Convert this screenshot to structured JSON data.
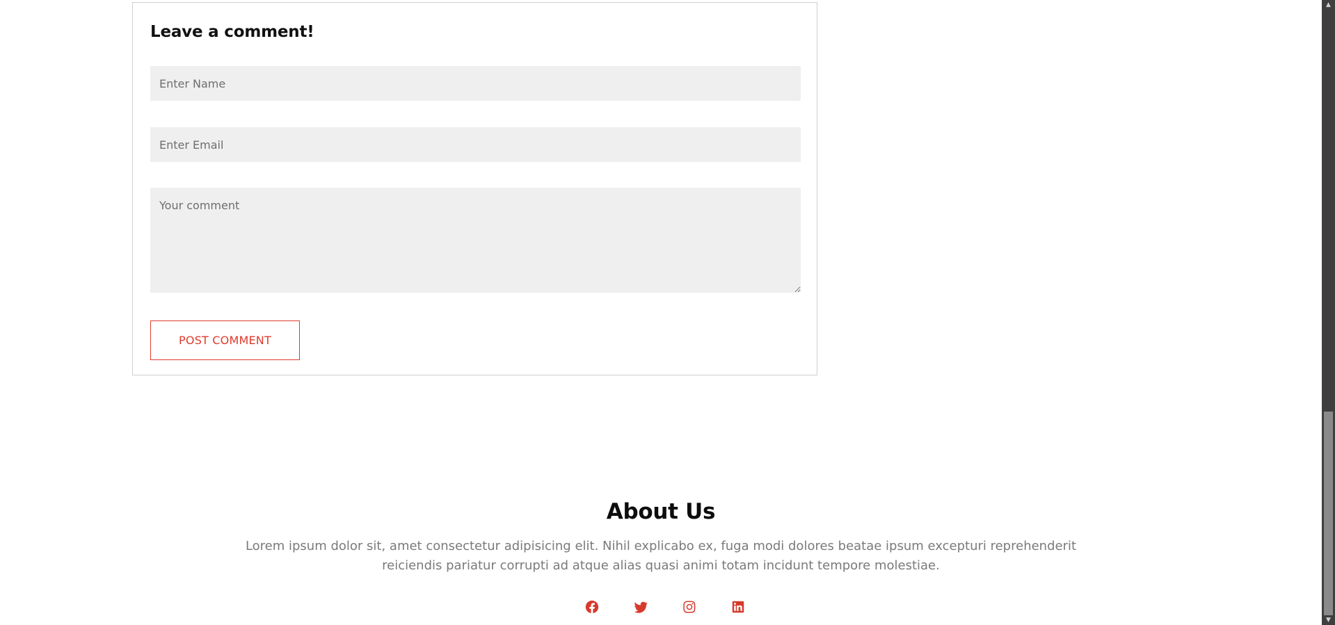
{
  "comment_form": {
    "title": "Leave a comment!",
    "name_placeholder": "Enter Name",
    "email_placeholder": "Enter Email",
    "comment_placeholder": "Your comment",
    "submit_label": "POST COMMENT"
  },
  "about": {
    "title": "About Us",
    "text": "Lorem ipsum dolor sit, amet consectetur adipisicing elit. Nihil explicabo ex, fuga modi dolores beatae ipsum excepturi reprehenderit reiciendis pariatur corrupti ad atque alias quasi animi totam incidunt tempore molestiae."
  },
  "social": [
    {
      "icon": "facebook-icon"
    },
    {
      "icon": "twitter-icon"
    },
    {
      "icon": "instagram-icon"
    },
    {
      "icon": "linkedin-icon"
    }
  ],
  "colors": {
    "accent": "#e0392b",
    "field_background": "#efefef",
    "muted_text": "#7a7a7a"
  }
}
